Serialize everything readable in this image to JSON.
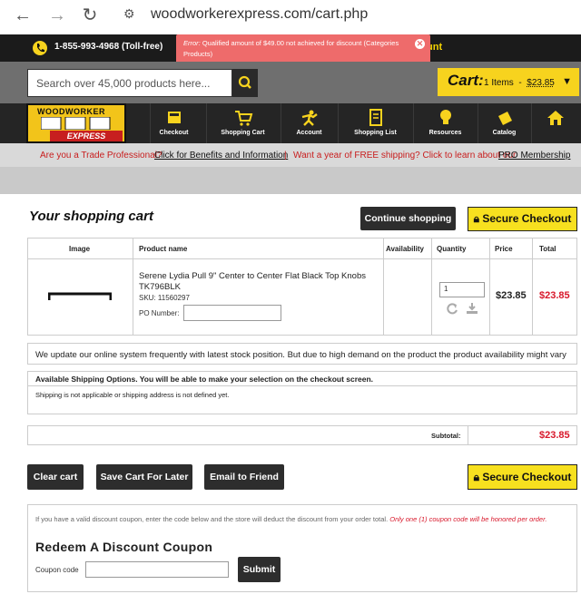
{
  "browser": {
    "url": "woodworkerexpress.com/cart.php"
  },
  "header": {
    "phone": "1-855-993-4968 (Toll-free)",
    "account_partial": "unt",
    "error": {
      "label": "Error:",
      "message": "Qualified amount of $49.00 not achieved for discount (Categories Products)"
    },
    "search_placeholder": "Search over 45,000 products here...",
    "cart": {
      "title": "Cart:",
      "items": "1 Items",
      "separator": "-",
      "amount": "$23.85"
    },
    "logo": {
      "line1": "WOODWORKER",
      "line2": "EXPRESS"
    }
  },
  "nav": [
    {
      "label": "Checkout",
      "icon": "register-icon"
    },
    {
      "label": "Shopping Cart",
      "icon": "cart-icon"
    },
    {
      "label": "Account",
      "icon": "person-icon"
    },
    {
      "label": "Shopping List",
      "icon": "list-icon"
    },
    {
      "label": "Resources",
      "icon": "lightbulb-icon"
    },
    {
      "label": "Catalog",
      "icon": "catalog-icon"
    },
    {
      "label": "",
      "icon": "home-icon"
    }
  ],
  "promo": {
    "q1": "Are you a Trade Professional?",
    "link1": "Click for Benefits and Information",
    "sep": "|",
    "q2": "Want a year of FREE shipping? Click to learn about our",
    "link2": "PRO Membership"
  },
  "main": {
    "heading": "Your shopping cart",
    "continue": "Continue shopping",
    "secure": "Secure Checkout",
    "columns": [
      "Image",
      "Product name",
      "Availability",
      "Quantity",
      "Price",
      "Total"
    ],
    "item": {
      "name": "Serene Lydia Pull 9\" Center to Center Flat Black Top Knobs TK796BLK",
      "sku": "SKU: 11560297",
      "po_label": "PO Number:",
      "quantity": "1",
      "price": "$23.85",
      "total": "$23.85"
    },
    "notice": "We update our online system frequently with latest stock position. But due to high demand on the product the product availability might vary",
    "shipping_title": "Available Shipping Options. You will be able to make your selection on the checkout screen.",
    "shipping_text": "Shipping is not applicable or shipping address is not defined yet.",
    "subtotal_label": "Subtotal:",
    "subtotal": "$23.85",
    "actions": {
      "clear": "Clear cart",
      "save": "Save Cart For Later",
      "email": "Email to Friend"
    },
    "coupon": {
      "info": "If you have a valid discount coupon, enter the code below and the store will deduct the discount from your order total.",
      "info_red": "Only one (1) coupon code will be honored per order.",
      "title": "Redeem A Discount Coupon",
      "label": "Coupon code",
      "submit": "Submit"
    }
  },
  "colors": {
    "accent": "#f7d31e",
    "price_red": "#d8182b",
    "error": "#ee6b6b"
  }
}
